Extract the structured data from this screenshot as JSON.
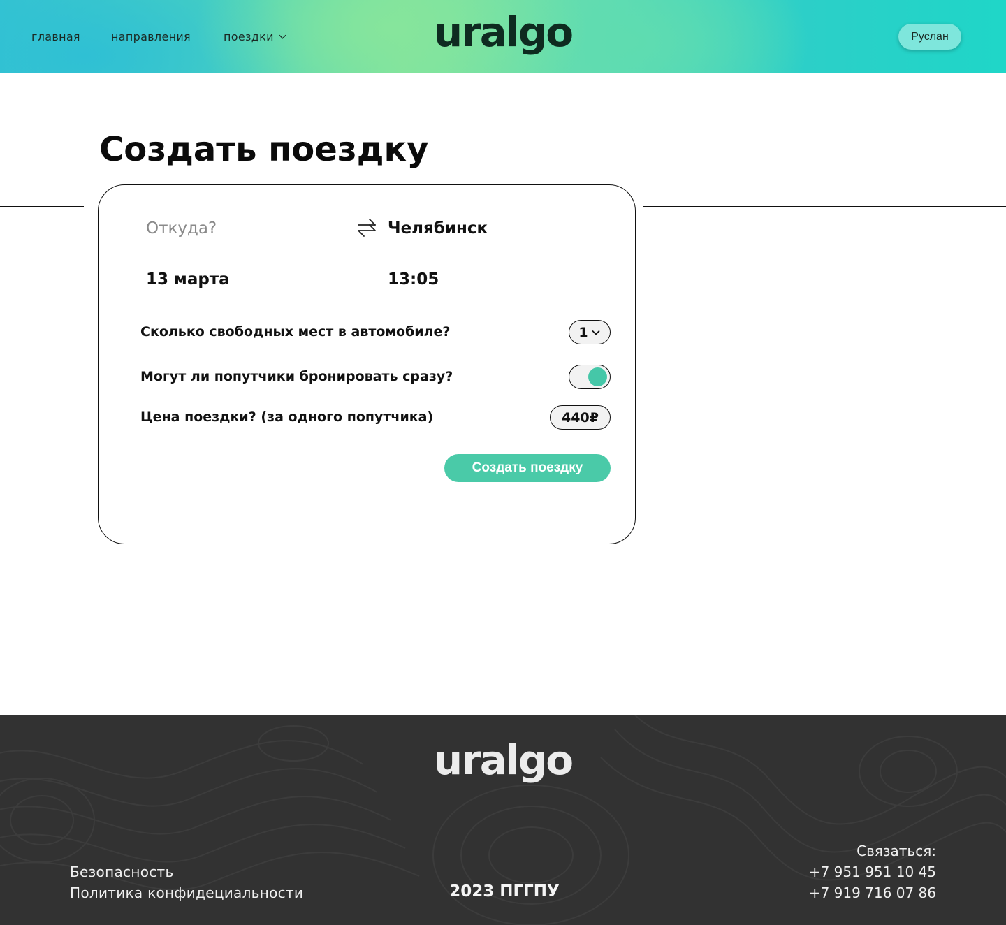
{
  "header": {
    "nav": {
      "home": "главная",
      "destinations": "направления",
      "trips": "поездки"
    },
    "logo": "uralgo",
    "user_name": "Руслан"
  },
  "main": {
    "title": "Создать поездку",
    "form": {
      "from_placeholder": "Откуда?",
      "to_value": "Челябинск",
      "date_value": "13 марта",
      "time_value": "13:05",
      "seats_question": "Сколько свободных мест в автомобиле?",
      "seats_value": "1",
      "instant_booking_question": "Могут ли попутчики бронировать сразу?",
      "instant_booking_enabled": true,
      "price_question": "Цена поездки? (за одного попутчика)",
      "price_value": "440₽",
      "submit_label": "Создать поездку"
    }
  },
  "footer": {
    "logo": "uralgo",
    "links": [
      "Безопасность",
      "Политика конфидециальности"
    ],
    "copyright": "2023 ПГГПУ",
    "contact_title": "Связаться:",
    "phones": [
      "+7 951 951 10 45",
      "+7 919 716 07 86"
    ]
  },
  "colors": {
    "accent": "#4acaa8",
    "footer_bg": "#323232",
    "logo_dark": "#0e2b20"
  }
}
